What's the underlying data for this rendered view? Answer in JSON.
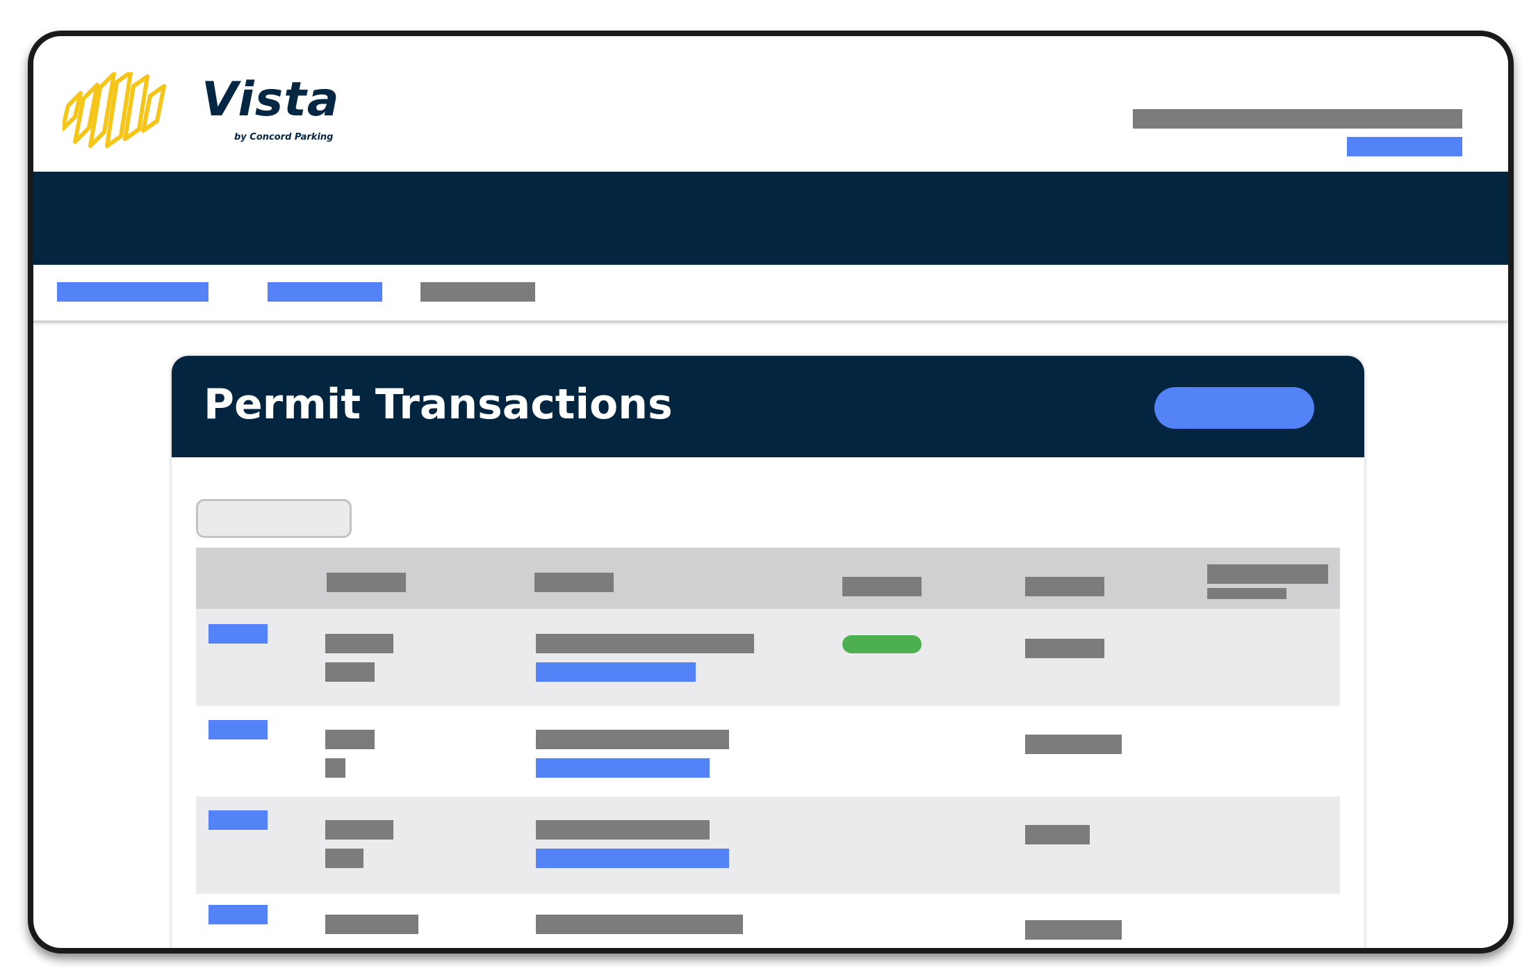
{
  "brand": {
    "name": "Vista",
    "tagline": "by Concord Parking",
    "accent_color": "#F5C518",
    "navy_color": "#03253F",
    "link_color": "#5383F7"
  },
  "header": {
    "user_info": "",
    "account_link": ""
  },
  "nav_tabs": [
    {
      "label": "",
      "active": true
    },
    {
      "label": "",
      "active": true
    },
    {
      "label": "",
      "active": false
    }
  ],
  "card": {
    "title": "Permit Transactions",
    "action_button_label": ""
  },
  "filter": {
    "placeholder": ""
  },
  "table": {
    "columns": [
      "",
      "",
      "",
      "",
      "",
      ""
    ],
    "rows": [
      {
        "id_link": "",
        "primary": "",
        "secondary": "",
        "desc": "",
        "desc_link": "",
        "status": "active",
        "value": ""
      },
      {
        "id_link": "",
        "primary": "",
        "secondary": "",
        "desc": "",
        "desc_link": "",
        "status": "",
        "value": ""
      },
      {
        "id_link": "",
        "primary": "",
        "secondary": "",
        "desc": "",
        "desc_link": "",
        "status": "",
        "value": ""
      },
      {
        "id_link": "",
        "primary": "",
        "secondary": "",
        "desc": "",
        "desc_link": "",
        "status": "",
        "value": ""
      }
    ],
    "status_color": "#4CAF50"
  }
}
